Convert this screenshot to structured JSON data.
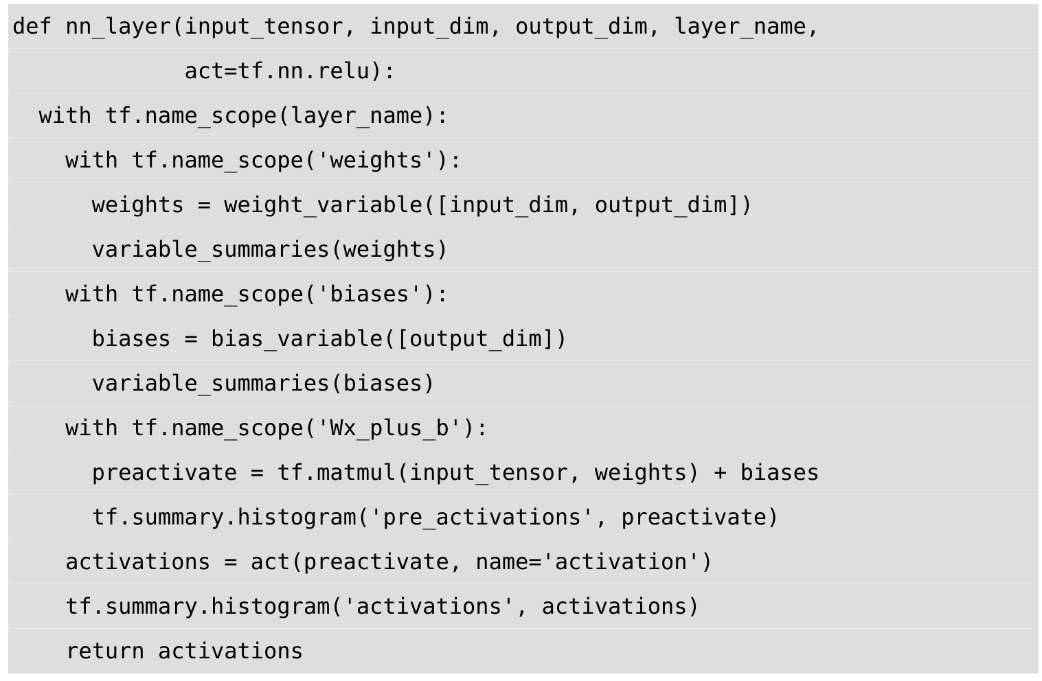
{
  "code": {
    "lines": [
      "def nn_layer(input_tensor, input_dim, output_dim, layer_name,",
      "             act=tf.nn.relu):",
      "  with tf.name_scope(layer_name):",
      "    with tf.name_scope('weights'):",
      "      weights = weight_variable([input_dim, output_dim])",
      "      variable_summaries(weights)",
      "    with tf.name_scope('biases'):",
      "      biases = bias_variable([output_dim])",
      "      variable_summaries(biases)",
      "    with tf.name_scope('Wx_plus_b'):",
      "      preactivate = tf.matmul(input_tensor, weights) + biases",
      "      tf.summary.histogram('pre_activations', preactivate)",
      "    activations = act(preactivate, name='activation')",
      "    tf.summary.histogram('activations', activations)",
      "    return activations"
    ]
  },
  "colors": {
    "background": "#dedede",
    "text": "#000000",
    "line_separator": "#e9e9e9"
  }
}
